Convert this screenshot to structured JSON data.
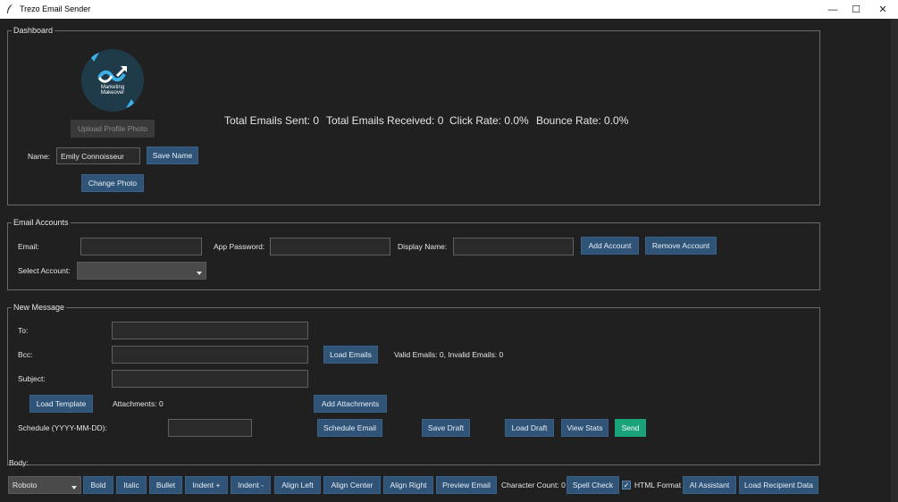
{
  "window": {
    "title": "Trezo Email Sender",
    "minimize": "—",
    "maximize": "☐",
    "close": "✕"
  },
  "dashboard": {
    "legend": "Dashboard",
    "logo_text_line1": "Marketing",
    "logo_text_line2": "Makeover",
    "upload_photo": "Upload Profile Photo",
    "name_label": "Name:",
    "name_value": "Emily Connoisseur",
    "save_name": "Save Name",
    "change_photo": "Change Photo",
    "stats": {
      "sent": "Total Emails Sent: 0",
      "received": "Total Emails Received: 0",
      "click_rate": "Click Rate: 0.0%",
      "bounce_rate": "Bounce Rate: 0.0%"
    }
  },
  "accounts": {
    "legend": "Email Accounts",
    "email_label": "Email:",
    "app_password_label": "App Password:",
    "display_name_label": "Display Name:",
    "add_account": "Add Account",
    "remove_account": "Remove Account",
    "select_account_label": "Select Account:",
    "select_account_value": ""
  },
  "message": {
    "legend": "New Message",
    "to_label": "To:",
    "bcc_label": "Bcc:",
    "subject_label": "Subject:",
    "load_emails": "Load Emails",
    "valid_invalid": "Valid Emails: 0, Invalid Emails: 0",
    "load_template": "Load Template",
    "attachments": "Attachments: 0",
    "add_attachments": "Add Attachments",
    "schedule_label": "Schedule (YYYY-MM-DD):",
    "schedule_email": "Schedule Email",
    "save_draft": "Save Draft",
    "load_draft": "Load Draft",
    "view_stats": "View Stats",
    "send": "Send"
  },
  "body": {
    "label": "Body:",
    "font_value": "Roboto",
    "bold": "Bold",
    "italic": "Italic",
    "bullet": "Bullet",
    "indent_plus": "Indent +",
    "indent_minus": "Indent -",
    "align_left": "Align Left",
    "align_center": "Align Center",
    "align_right": "Align Right",
    "preview_email": "Preview Email",
    "char_count": "Character Count: 0",
    "spell_check": "Spell Check",
    "html_format_check": "✓",
    "html_format": "HTML Format",
    "ai_assistant": "AI Assistant",
    "load_recipient_data": "Load Recipient Data"
  }
}
